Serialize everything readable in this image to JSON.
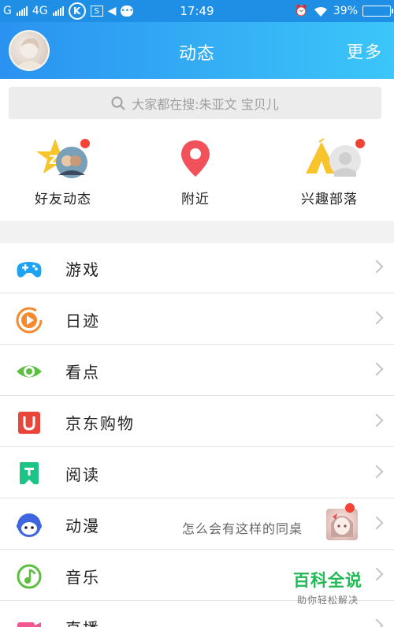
{
  "status_bar": {
    "carrier1": "G",
    "carrier2": "4G",
    "time": "17:49",
    "battery": "39%"
  },
  "header": {
    "title": "动态",
    "more_label": "更多"
  },
  "search": {
    "placeholder": "大家都在搜:朱亚文 宝贝儿"
  },
  "quick_entries": [
    {
      "label": "好友动态",
      "icon": "friends-feed-icon",
      "has_badge": true
    },
    {
      "label": "附近",
      "icon": "location-pin-icon",
      "has_badge": false
    },
    {
      "label": "兴趣部落",
      "icon": "tribe-icon",
      "has_badge": true
    }
  ],
  "list": [
    {
      "label": "游戏",
      "icon": "gamepad-icon",
      "color": "#1ea3f3"
    },
    {
      "label": "日迹",
      "icon": "play-circle-icon",
      "color": "#f4892e"
    },
    {
      "label": "看点",
      "icon": "eye-icon",
      "color": "#5bbf3f"
    },
    {
      "label": "京东购物",
      "icon": "jd-cart-icon",
      "color": "#e8463b"
    },
    {
      "label": "阅读",
      "icon": "bookmark-icon",
      "color": "#1ec486"
    },
    {
      "label": "动漫",
      "icon": "anime-face-icon",
      "color": "#3f66e0",
      "subtitle": "怎么会有这样的同桌",
      "has_badge": true
    },
    {
      "label": "音乐",
      "icon": "music-note-icon",
      "color": "#5bbf3f"
    },
    {
      "label": "直播",
      "icon": "camera-icon",
      "color": "#f2578f"
    }
  ],
  "watermark": {
    "title": "百科全说",
    "subtitle": "助你轻松解决"
  },
  "colors": {
    "header_start": "#2a92f0",
    "header_end": "#3cc6f9",
    "badge": "#f44336"
  }
}
